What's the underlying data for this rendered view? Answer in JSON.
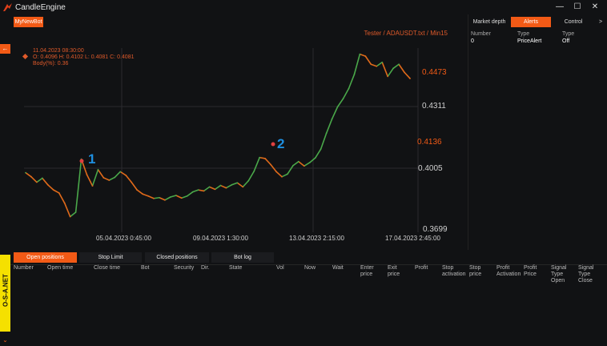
{
  "app": {
    "title": "CandleEngine"
  },
  "window_controls": {
    "minimize": "—",
    "maximize": "☐",
    "close": "✕"
  },
  "bot_tab": {
    "label": "MyNewBot"
  },
  "left_collapse": {
    "symbol": "←"
  },
  "chart": {
    "source_label": "Tester / ADAUSDT.txt / Min15",
    "info_line1": "11.04.2023 08:30:00",
    "info_line2": "O: 0.4096 H: 0.4102 L: 0.4081 C: 0.4081",
    "info_line3": "Body(%): 0.36",
    "markers": [
      "1",
      "2"
    ],
    "price_labels": [
      "0.4473",
      "0.4311",
      "0.4136",
      "0.4005",
      "0.3699"
    ],
    "time_labels": [
      "05.04.2023 0:45:00",
      "09.04.2023 1:30:00",
      "13.04.2023 2:15:00",
      "17.04.2023 2:45:00"
    ]
  },
  "chart_data": {
    "type": "line",
    "title": "Tester / ADAUSDT.txt / Min15",
    "x": [
      "05.04.2023 0:45:00",
      "09.04.2023 1:30:00",
      "13.04.2023 2:15:00",
      "17.04.2023 2:45:00"
    ],
    "ylim": [
      0.3699,
      0.46
    ],
    "series": [
      {
        "name": "ADAUSDT",
        "values": [
          0.3985,
          0.3965,
          0.3938,
          0.3958,
          0.3925,
          0.39,
          0.3885,
          0.3835,
          0.3768,
          0.379,
          0.4052,
          0.3975,
          0.392,
          0.4,
          0.396,
          0.3948,
          0.3962,
          0.399,
          0.3972,
          0.3938,
          0.39,
          0.388,
          0.387,
          0.3858,
          0.3862,
          0.385,
          0.3865,
          0.3873,
          0.386,
          0.387,
          0.389,
          0.39,
          0.3895,
          0.3915,
          0.3903,
          0.3922,
          0.391,
          0.3925,
          0.3935,
          0.3915,
          0.3945,
          0.3992,
          0.406,
          0.4055,
          0.4025,
          0.399,
          0.3965,
          0.3978,
          0.402,
          0.404,
          0.4018,
          0.4035,
          0.4058,
          0.4102,
          0.418,
          0.425,
          0.431,
          0.435,
          0.44,
          0.447,
          0.457,
          0.456,
          0.452,
          0.451,
          0.453,
          0.446,
          0.45,
          0.452,
          0.448,
          0.445
        ]
      }
    ],
    "annotations": [
      "1",
      "2"
    ],
    "grid": true,
    "colors": {
      "up": "#4aa84a",
      "down": "#e06a1a",
      "marker": "#1e8fe0",
      "alert_label": "#f25a16"
    }
  },
  "right_panel": {
    "tabs": [
      "Market depth",
      "Alerts",
      "Control"
    ],
    "more": ">",
    "headers": [
      "Number",
      "Type",
      "Type"
    ],
    "row": [
      "0",
      "PriceAlert",
      "Off"
    ]
  },
  "bottom": {
    "tabs": [
      "Open positions",
      "Stop Limit",
      "Closed positions",
      "Bot log"
    ],
    "columns": [
      "Number",
      "Open time",
      "Close time",
      "Bot",
      "Security",
      "Dir.",
      "State",
      "Vol",
      "Now",
      "Wait",
      "Enter\nprice",
      "Exit\nprice",
      "Profit",
      "Stop\nactivation",
      "Stop\nprice",
      "Profit\nActivation",
      "Profit\nPrice",
      "Signal\nType\nOpen",
      "Signal\nType\nClose"
    ]
  },
  "sidebar": {
    "label": "O-S-A.NET",
    "arrow": "⌄"
  },
  "colors": {
    "accent": "#f25a16",
    "background": "#111214",
    "brand_yellow": "#f5e000"
  }
}
